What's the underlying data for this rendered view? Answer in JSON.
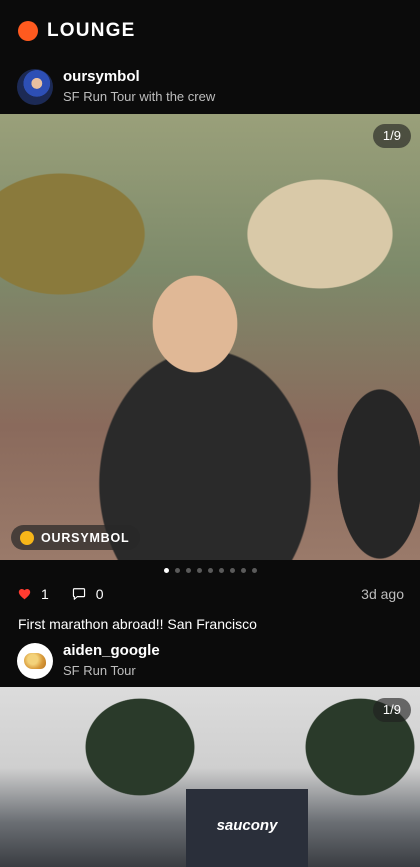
{
  "app": {
    "title": "LOUNGE",
    "accent_color": "#ff5a1f"
  },
  "posts": [
    {
      "author": "oursymbol",
      "subtitle": "SF Run Tour with the crew",
      "photo_counter": "1/9",
      "tag": {
        "label": "OURSYMBOL",
        "icon": "yellow-circle",
        "color": "#f7b619"
      },
      "carousel": {
        "total": 9,
        "active": 1
      },
      "likes": "1",
      "comments": "0",
      "time_ago": "3d ago",
      "caption": "First marathon abroad!! San Francisco"
    },
    {
      "author": "aiden_google",
      "subtitle": "SF Run Tour",
      "photo_counter": "1/9",
      "banner_text": "saucony"
    }
  ],
  "icons": {
    "like": "heart-icon",
    "comment": "comment-icon",
    "like_color": "#ff3b30"
  }
}
